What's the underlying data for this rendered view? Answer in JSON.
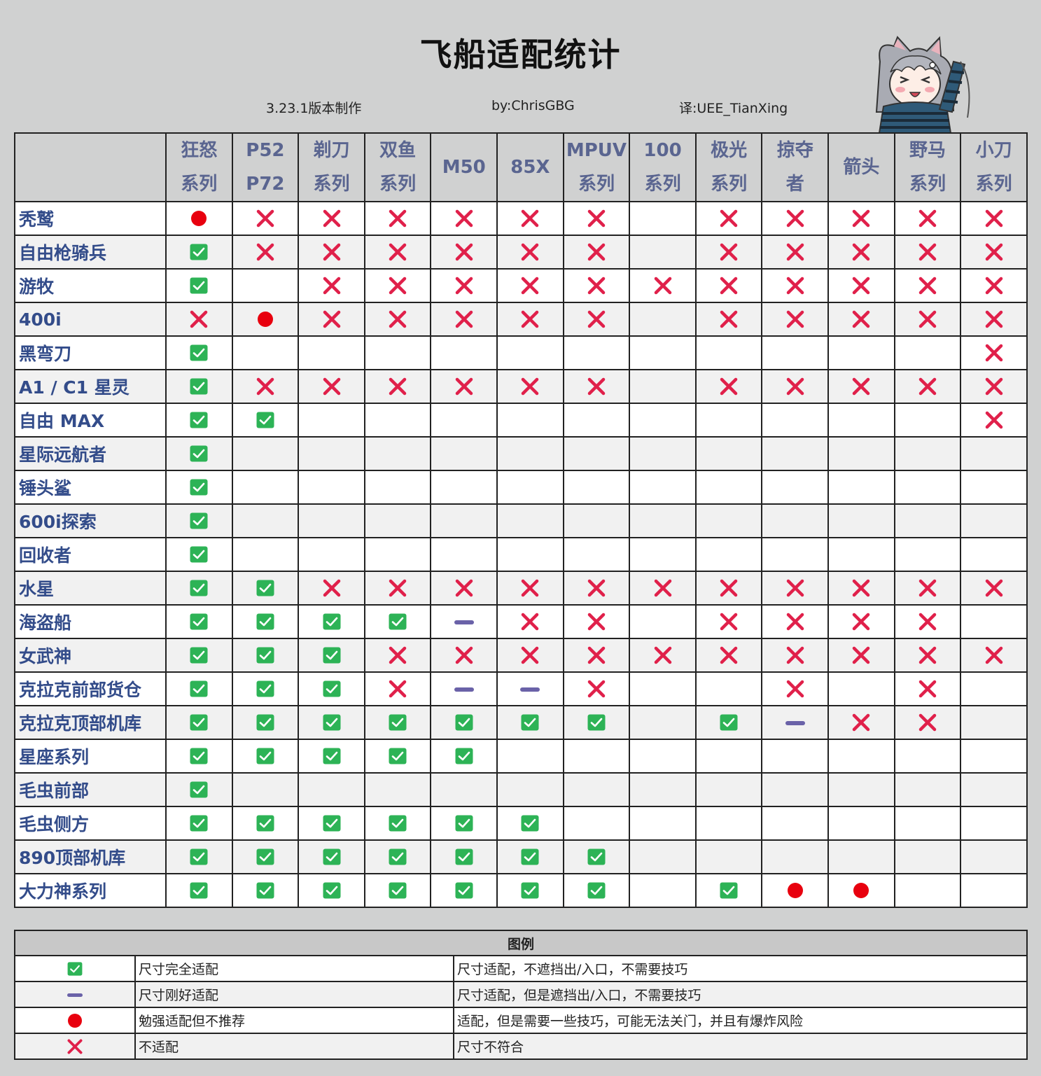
{
  "title": "飞船适配统计",
  "meta": {
    "version": "3.23.1版本制作",
    "author": "by:ChrisGBG",
    "translator": "译:UEE_TianXing"
  },
  "colors": {
    "check": "#2db356",
    "cross": "#e0204a",
    "dot": "#e8000e",
    "dash": "#6a62a8",
    "header_text": "#5a6590",
    "row_label_text": "#334c8a"
  },
  "columns": [
    {
      "line1": "狂怒",
      "line2": "系列"
    },
    {
      "line1": "P52",
      "line2": "P72"
    },
    {
      "line1": "剃刀",
      "line2": "系列"
    },
    {
      "line1": "双鱼",
      "line2": "系列"
    },
    {
      "line1": "M50",
      "line2": ""
    },
    {
      "line1": "85X",
      "line2": ""
    },
    {
      "line1": "MPUV",
      "line2": "系列"
    },
    {
      "line1": "100",
      "line2": "系列"
    },
    {
      "line1": "极光",
      "line2": "系列"
    },
    {
      "line1": "掠夺",
      "line2": "者"
    },
    {
      "line1": "箭头",
      "line2": ""
    },
    {
      "line1": "野马",
      "line2": "系列"
    },
    {
      "line1": "小刀",
      "line2": "系列"
    }
  ],
  "rows": [
    {
      "name": "秃鹫",
      "cells": [
        "dot",
        "cross",
        "cross",
        "cross",
        "cross",
        "cross",
        "cross",
        "",
        "cross",
        "cross",
        "cross",
        "cross",
        "cross"
      ]
    },
    {
      "name": "自由枪骑兵",
      "cells": [
        "check",
        "cross",
        "cross",
        "cross",
        "cross",
        "cross",
        "cross",
        "",
        "cross",
        "cross",
        "cross",
        "cross",
        "cross"
      ]
    },
    {
      "name": "游牧",
      "cells": [
        "check",
        "",
        "cross",
        "cross",
        "cross",
        "cross",
        "cross",
        "cross",
        "cross",
        "cross",
        "cross",
        "cross",
        "cross"
      ]
    },
    {
      "name": "400i",
      "cells": [
        "cross",
        "dot",
        "cross",
        "cross",
        "cross",
        "cross",
        "cross",
        "",
        "cross",
        "cross",
        "cross",
        "cross",
        "cross"
      ]
    },
    {
      "name": "黑弯刀",
      "cells": [
        "check",
        "",
        "",
        "",
        "",
        "",
        "",
        "",
        "",
        "",
        "",
        "",
        "cross"
      ]
    },
    {
      "name": "A1 / C1 星灵",
      "cells": [
        "check",
        "cross",
        "cross",
        "cross",
        "cross",
        "cross",
        "cross",
        "",
        "cross",
        "cross",
        "cross",
        "cross",
        "cross"
      ]
    },
    {
      "name": "自由 MAX",
      "cells": [
        "check",
        "check",
        "",
        "",
        "",
        "",
        "",
        "",
        "",
        "",
        "",
        "",
        "cross"
      ]
    },
    {
      "name": "星际远航者",
      "cells": [
        "check",
        "",
        "",
        "",
        "",
        "",
        "",
        "",
        "",
        "",
        "",
        "",
        ""
      ]
    },
    {
      "name": "锤头鲨",
      "cells": [
        "check",
        "",
        "",
        "",
        "",
        "",
        "",
        "",
        "",
        "",
        "",
        "",
        ""
      ]
    },
    {
      "name": "600i探索",
      "cells": [
        "check",
        "",
        "",
        "",
        "",
        "",
        "",
        "",
        "",
        "",
        "",
        "",
        ""
      ]
    },
    {
      "name": "回收者",
      "cells": [
        "check",
        "",
        "",
        "",
        "",
        "",
        "",
        "",
        "",
        "",
        "",
        "",
        ""
      ]
    },
    {
      "name": "水星",
      "cells": [
        "check",
        "check",
        "cross",
        "cross",
        "cross",
        "cross",
        "cross",
        "cross",
        "cross",
        "cross",
        "cross",
        "cross",
        "cross"
      ]
    },
    {
      "name": "海盗船",
      "cells": [
        "check",
        "check",
        "check",
        "check",
        "dash",
        "cross",
        "cross",
        "",
        "cross",
        "cross",
        "cross",
        "cross",
        ""
      ]
    },
    {
      "name": "女武神",
      "cells": [
        "check",
        "check",
        "check",
        "cross",
        "cross",
        "cross",
        "cross",
        "cross",
        "cross",
        "cross",
        "cross",
        "cross",
        "cross"
      ]
    },
    {
      "name": "克拉克前部货仓",
      "cells": [
        "check",
        "check",
        "check",
        "cross",
        "dash",
        "dash",
        "cross",
        "",
        "",
        "cross",
        "",
        "cross",
        ""
      ]
    },
    {
      "name": "克拉克顶部机库",
      "cells": [
        "check",
        "check",
        "check",
        "check",
        "check",
        "check",
        "check",
        "",
        "check",
        "dash",
        "cross",
        "cross",
        ""
      ]
    },
    {
      "name": "星座系列",
      "cells": [
        "check",
        "check",
        "check",
        "check",
        "check",
        "",
        "",
        "",
        "",
        "",
        "",
        "",
        ""
      ]
    },
    {
      "name": "毛虫前部",
      "cells": [
        "check",
        "",
        "",
        "",
        "",
        "",
        "",
        "",
        "",
        "",
        "",
        "",
        ""
      ]
    },
    {
      "name": "毛虫侧方",
      "cells": [
        "check",
        "check",
        "check",
        "check",
        "check",
        "check",
        "",
        "",
        "",
        "",
        "",
        "",
        ""
      ]
    },
    {
      "name": "890顶部机库",
      "cells": [
        "check",
        "check",
        "check",
        "check",
        "check",
        "check",
        "check",
        "",
        "",
        "",
        "",
        "",
        ""
      ]
    },
    {
      "name": "大力神系列",
      "cells": [
        "check",
        "check",
        "check",
        "check",
        "check",
        "check",
        "check",
        "",
        "check",
        "dot",
        "dot",
        "",
        ""
      ]
    }
  ],
  "legend": {
    "title": "图例",
    "items": [
      {
        "symbol": "check",
        "label": "尺寸完全适配",
        "desc": "尺寸适配，不遮挡出/入口，不需要技巧"
      },
      {
        "symbol": "dash",
        "label": "尺寸刚好适配",
        "desc": "尺寸适配，但是遮挡出/入口，不需要技巧"
      },
      {
        "symbol": "dot",
        "label": "勉强适配但不推荐",
        "desc": "适配，但是需要一些技巧，可能无法关门，并且有爆炸风险"
      },
      {
        "symbol": "cross",
        "label": "不适配",
        "desc": "尺寸不符合"
      }
    ]
  },
  "mascot_icon": "cat-ear-anime-girl-icon"
}
